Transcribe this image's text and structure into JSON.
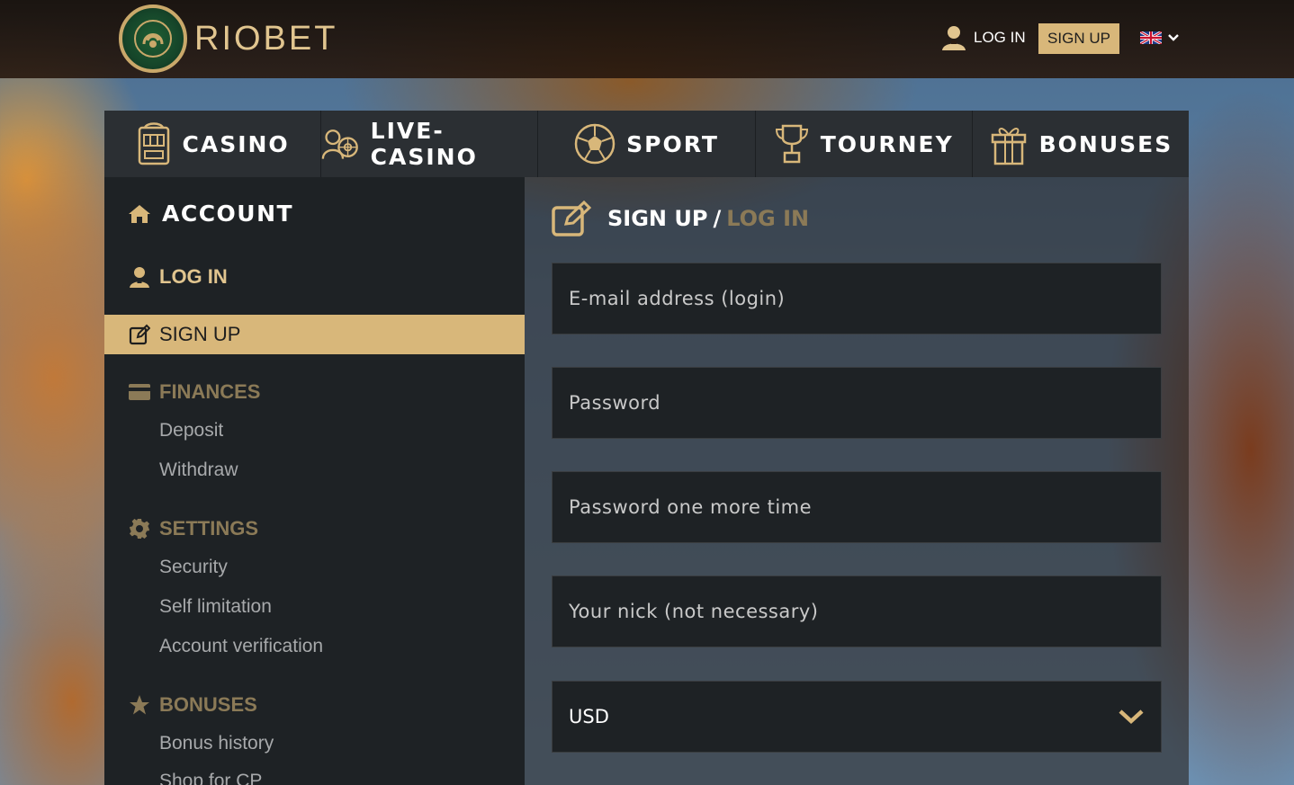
{
  "header": {
    "brand": "RIOBET",
    "login_label": "LOG IN",
    "signup_label": "SIGN UP",
    "language": "EN"
  },
  "nav": {
    "items": [
      {
        "label": "CASINO",
        "icon": "slot-machine-icon"
      },
      {
        "label": "LIVE-CASINO",
        "icon": "dealer-roulette-icon"
      },
      {
        "label": "SPORT",
        "icon": "soccer-ball-icon"
      },
      {
        "label": "TOURNEY",
        "icon": "trophy-icon"
      },
      {
        "label": "BONUSES",
        "icon": "gift-icon"
      }
    ]
  },
  "sidebar": {
    "title": "ACCOUNT",
    "login": "LOG IN",
    "signup": "SIGN UP",
    "finances": {
      "label": "FINANCES",
      "items": [
        "Deposit",
        "Withdraw"
      ]
    },
    "settings": {
      "label": "SETTINGS",
      "items": [
        "Security",
        "Self limitation",
        "Account verification"
      ]
    },
    "bonuses": {
      "label": "BONUSES",
      "items": [
        "Bonus history",
        "Shop for CP"
      ]
    }
  },
  "form": {
    "title_signup": "SIGN UP",
    "title_sep": "/",
    "title_login": "LOG IN",
    "email_placeholder": "E-mail address (login)",
    "password_placeholder": "Password",
    "password2_placeholder": "Password one more time",
    "nick_placeholder": "Your nick (not necessary)",
    "currency": "USD"
  },
  "colors": {
    "accent": "#d8b77a",
    "panel": "#1e2225",
    "nav": "#2b2f33",
    "muted_gold": "#8b7a57"
  }
}
